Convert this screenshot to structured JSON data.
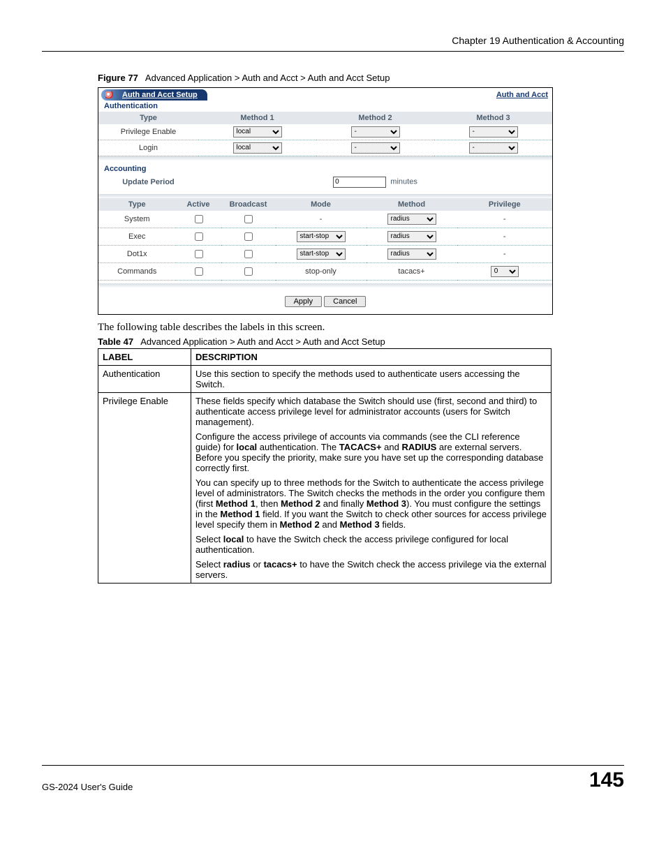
{
  "chapter": "Chapter 19 Authentication & Accounting",
  "figure": {
    "num": "Figure 77",
    "caption": "Advanced Application > Auth and Acct > Auth and Acct Setup"
  },
  "app": {
    "title": "Auth and Acct Setup",
    "link": "Auth and Acct",
    "auth_section": "Authentication",
    "auth_headers": {
      "type": "Type",
      "m1": "Method 1",
      "m2": "Method 2",
      "m3": "Method 3"
    },
    "auth_rows": [
      {
        "label": "Privilege Enable",
        "m1": "local",
        "m2": "-",
        "m3": "-"
      },
      {
        "label": "Login",
        "m1": "local",
        "m2": "-",
        "m3": "-"
      }
    ],
    "acct_section": "Accounting",
    "update_label": "Update Period",
    "update_value": "0",
    "update_unit": "minutes",
    "acct_headers": {
      "type": "Type",
      "active": "Active",
      "broadcast": "Broadcast",
      "mode": "Mode",
      "method": "Method",
      "priv": "Privilege"
    },
    "acct_rows": [
      {
        "label": "System",
        "active": false,
        "broadcast": false,
        "mode_text": "-",
        "mode_sel": null,
        "method_sel": "radius",
        "method_text": null,
        "priv_text": "-",
        "priv_sel": null
      },
      {
        "label": "Exec",
        "active": false,
        "broadcast": false,
        "mode_text": null,
        "mode_sel": "start-stop",
        "method_sel": "radius",
        "method_text": null,
        "priv_text": "-",
        "priv_sel": null
      },
      {
        "label": "Dot1x",
        "active": false,
        "broadcast": false,
        "mode_text": null,
        "mode_sel": "start-stop",
        "method_sel": "radius",
        "method_text": null,
        "priv_text": "-",
        "priv_sel": null
      },
      {
        "label": "Commands",
        "active": false,
        "broadcast": false,
        "mode_text": "stop-only",
        "mode_sel": null,
        "method_sel": null,
        "method_text": "tacacs+",
        "priv_text": null,
        "priv_sel": "0"
      }
    ],
    "buttons": {
      "apply": "Apply",
      "cancel": "Cancel"
    }
  },
  "body_text": "The following table describes the labels in this screen.",
  "table": {
    "num": "Table 47",
    "caption": "Advanced Application > Auth and Acct > Auth and Acct Setup",
    "h_label": "LABEL",
    "h_desc": "DESCRIPTION",
    "rows": [
      {
        "label": "Authentication",
        "desc_html": "Use this section to specify the methods used to authenticate users accessing the Switch."
      },
      {
        "label": "Privilege Enable",
        "desc_html": "<p>These fields specify which database the Switch should use (first, second and third) to authenticate access privilege level for administrator accounts (users for Switch management).</p><p>Configure the access privilege of accounts via commands (see the CLI reference guide) for <b>local</b> authentication. The <b>TACACS+</b> and <b>RADIUS</b> are external servers. Before you specify the priority, make sure you have set up the corresponding database correctly first.</p><p>You can specify up to three methods for the Switch to authenticate the access privilege level of administrators. The Switch checks the methods in the order you configure them (first <b>Method 1</b>, then <b>Method 2</b> and finally <b>Method 3</b>). You must configure the settings in the <b>Method 1</b> field. If you want the Switch to check other sources for access privilege level specify them in <b>Method 2</b> and <b>Method 3</b> fields.</p><p>Select <b>local</b> to have the Switch check the access privilege configured for local authentication.</p><p>Select <b>radius</b> or <b>tacacs+</b> to have the Switch check the access privilege via the external servers.</p>"
      }
    ]
  },
  "footer": {
    "guide": "GS-2024 User's Guide",
    "page": "145"
  }
}
